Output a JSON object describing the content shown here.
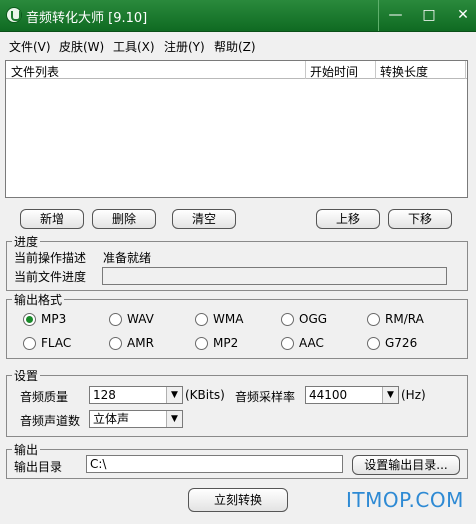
{
  "window": {
    "title": "音频转化大师 [9.10]",
    "minimize": "—",
    "maximize": "□",
    "close": "✕"
  },
  "menu": [
    "文件(V)",
    "皮肤(W)",
    "工具(X)",
    "注册(Y)",
    "帮助(Z)"
  ],
  "file_list": {
    "columns": [
      "文件列表",
      "开始时间",
      "转换长度"
    ]
  },
  "buttons": {
    "add": "新增",
    "delete": "删除",
    "clear": "清空",
    "move_up": "上移",
    "move_down": "下移",
    "set_output_dir": "设置输出目录...",
    "convert": "立刻转换"
  },
  "progress": {
    "legend": "进度",
    "op_label": "当前操作描述",
    "op_value": "准备就绪",
    "file_progress_label": "当前文件进度"
  },
  "format": {
    "legend": "输出格式",
    "options": [
      "MP3",
      "WAV",
      "WMA",
      "OGG",
      "RM/RA",
      "FLAC",
      "AMR",
      "MP2",
      "AAC",
      "G726"
    ],
    "selected": "MP3"
  },
  "settings": {
    "legend": "设置",
    "quality_label": "音频质量",
    "quality_value": "128",
    "quality_unit": "(KBits)",
    "rate_label": "音频采样率",
    "rate_value": "44100",
    "rate_unit": "(Hz)",
    "channels_label": "音频声道数",
    "channels_value": "立体声"
  },
  "output": {
    "legend": "输出",
    "dir_label": "输出目录",
    "dir_value": "C:\\"
  },
  "watermark": "ITMOP.COM"
}
